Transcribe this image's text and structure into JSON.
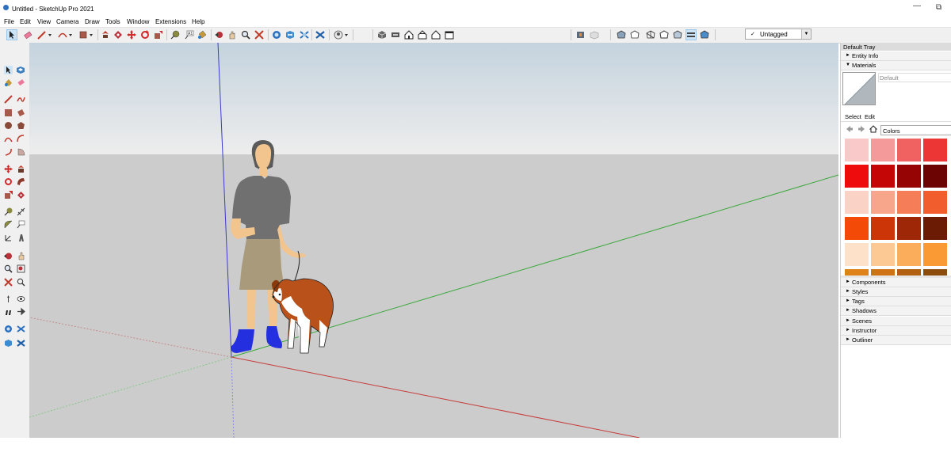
{
  "window": {
    "title": "Untitled - SketchUp Pro 2021"
  },
  "menu": [
    "File",
    "Edit",
    "View",
    "Camera",
    "Draw",
    "Tools",
    "Window",
    "Extensions",
    "Help"
  ],
  "toolbar": {
    "tags_check": "✓",
    "tags_value": "Untagged"
  },
  "tray": {
    "title": "Default Tray",
    "panels_top": [
      "Entity Info",
      "Materials"
    ],
    "materials": {
      "current_name": "Default",
      "tabs": [
        "Select",
        "Edit"
      ],
      "library": "Colors",
      "swatches": [
        "#f9c8c8",
        "#f59a9a",
        "#f06262",
        "#ec3535",
        "#ee0c0c",
        "#c40606",
        "#960404",
        "#6d0404",
        "#fad2c6",
        "#f7a68c",
        "#f57d57",
        "#f25d2d",
        "#f34a08",
        "#cc3508",
        "#9d2706",
        "#6b1a04",
        "#fde1c8",
        "#fcc893",
        "#fbad5c",
        "#f99a34",
        "#e0821c",
        "#cf7115",
        "#b0600f",
        "#8c4c0c"
      ]
    },
    "panels_bottom": [
      "Components",
      "Styles",
      "Tags",
      "Shadows",
      "Scenes",
      "Instructor",
      "Outliner"
    ]
  }
}
